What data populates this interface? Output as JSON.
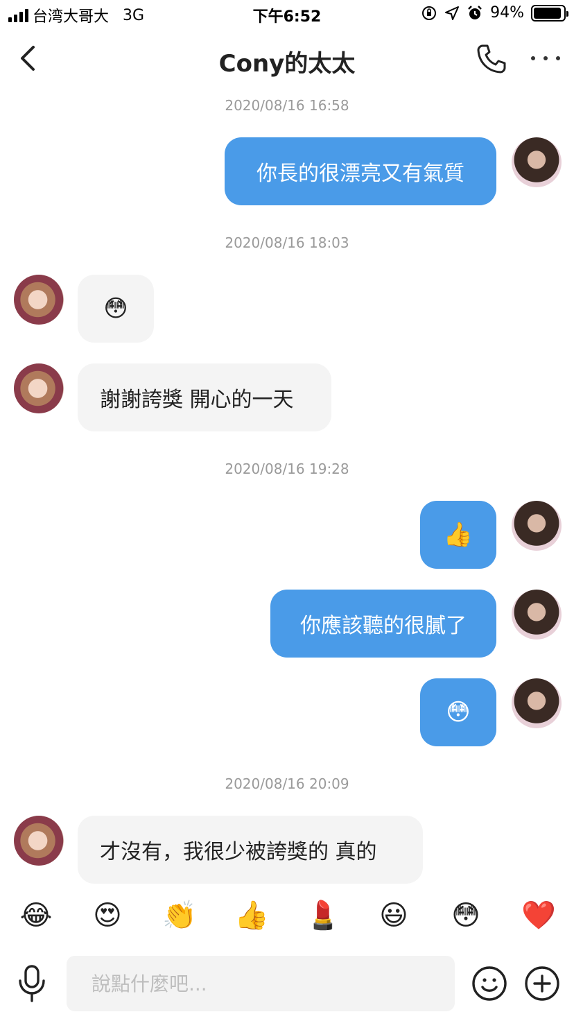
{
  "status_bar": {
    "carrier": "台湾大哥大",
    "network": "3G",
    "time": "下午6:52",
    "battery": "94%",
    "battery_level": 0.94
  },
  "nav": {
    "title": "Cony的太太",
    "back_icon": "chevron-left-icon",
    "call_icon": "phone-icon",
    "more_icon": "more-icon"
  },
  "messages": [
    {
      "timestamp": "2020/08/16 16:58"
    },
    {
      "from": "self",
      "text": "你長的很漂亮又有氣質"
    },
    {
      "timestamp": "2020/08/16 18:03"
    },
    {
      "from": "other",
      "text": "😳"
    },
    {
      "from": "other",
      "text": "謝謝誇獎 開心的一天"
    },
    {
      "timestamp": "2020/08/16 19:28"
    },
    {
      "from": "self",
      "text": "👍"
    },
    {
      "from": "self",
      "text": "你應該聽的很膩了"
    },
    {
      "from": "self",
      "text": "😳"
    },
    {
      "timestamp": "2020/08/16 20:09"
    },
    {
      "from": "other",
      "text": "才沒有，我很少被誇獎的 真的"
    }
  ],
  "quick_emojis": [
    "😂",
    "😍",
    "👏",
    "👍",
    "💄",
    "😃",
    "😳",
    "❤️"
  ],
  "input": {
    "placeholder": "說點什麼吧...",
    "value": ""
  },
  "colors": {
    "outgoing_bubble": "#4a9be8",
    "incoming_bubble": "#f4f4f4",
    "timestamp": "#9a9a9a"
  }
}
